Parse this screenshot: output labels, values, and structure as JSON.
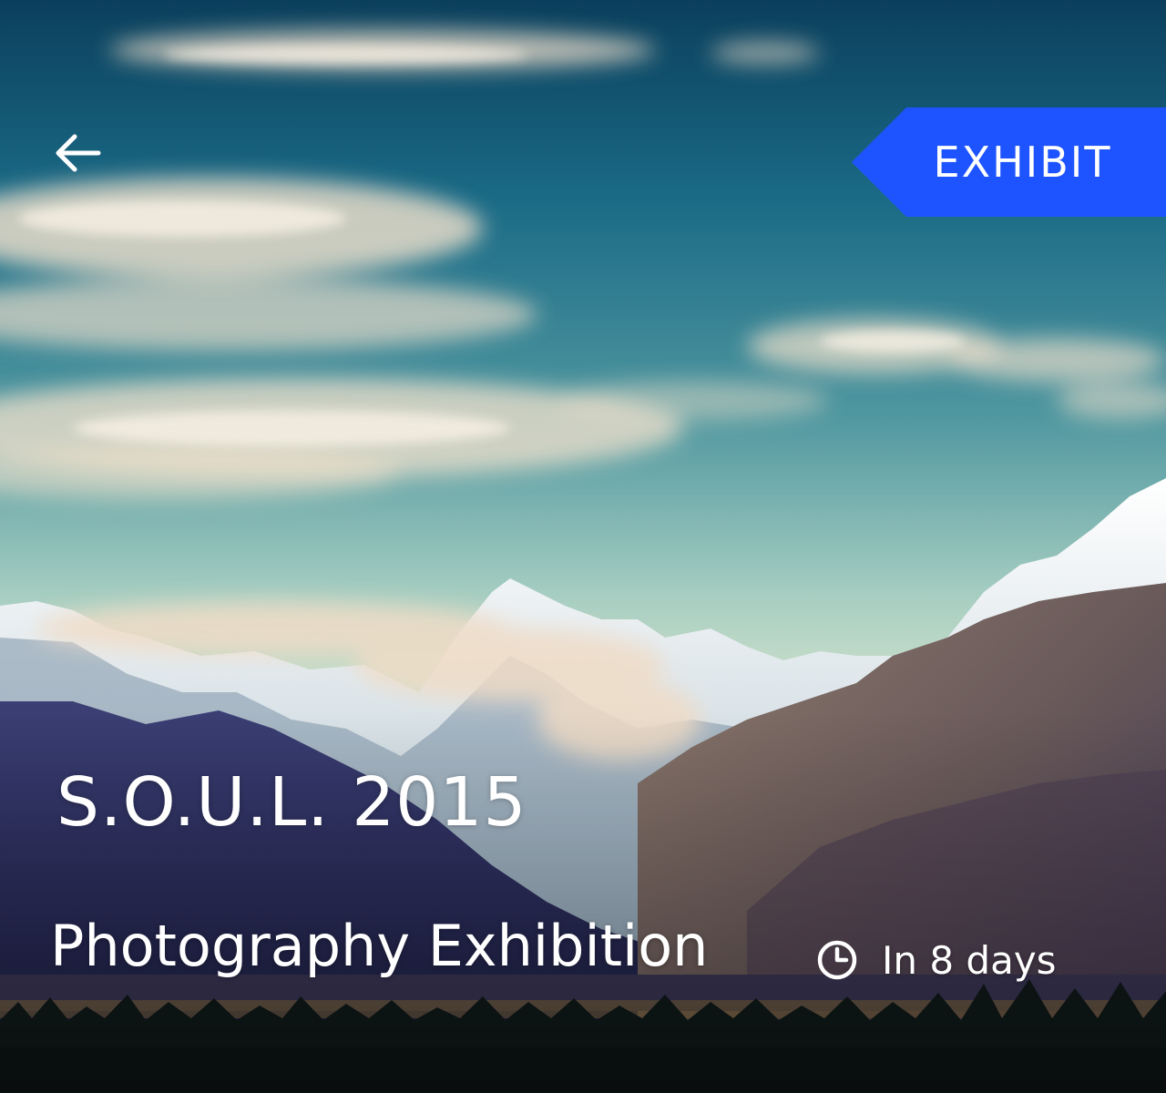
{
  "header": {
    "back_icon": "arrow-left-icon",
    "tag": {
      "label": "EXHIBIT",
      "color": "#1e54ff"
    }
  },
  "event": {
    "title": "S.O.U.L. 2015",
    "subtitle": "Photography Exhibition",
    "countdown": {
      "icon": "clock-icon",
      "text": "In 8 days"
    }
  }
}
